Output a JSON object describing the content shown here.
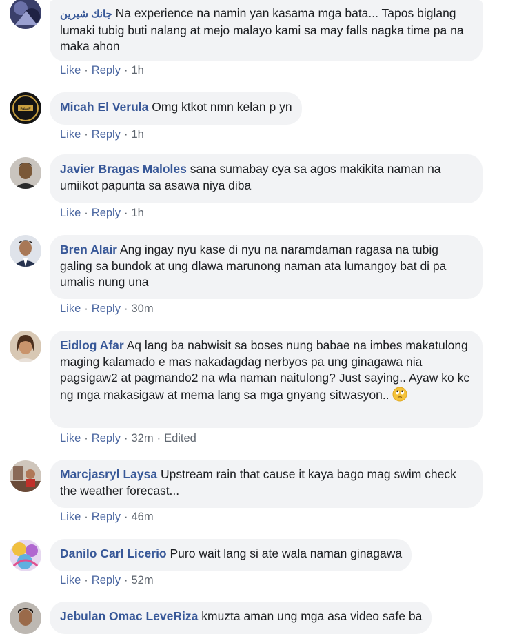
{
  "comments": [
    {
      "author": "جانك شيرين",
      "text": "Na experience na namin yan kasama mga bata... Tapos biglang lumaki tubig buti nalang at mejo malayo kami sa may falls nagka time pa na maka ahon",
      "like": "Like",
      "reply": "Reply",
      "time": "1h",
      "edited": ""
    },
    {
      "author": "Micah El Verula",
      "text": "Omg ktkot nmn kelan p yn",
      "like": "Like",
      "reply": "Reply",
      "time": "1h",
      "edited": ""
    },
    {
      "author": "Javier Bragas Maloles",
      "text": "sana sumabay cya sa agos makikita naman na umiikot papunta sa asawa niya diba",
      "like": "Like",
      "reply": "Reply",
      "time": "1h",
      "edited": ""
    },
    {
      "author": "Bren Alair",
      "text": "Ang ingay nyu kase di nyu na naramdaman ragasa na tubig galing sa bundok at ung dlawa marunong naman ata lumangoy bat di pa umalis nung una",
      "like": "Like",
      "reply": "Reply",
      "time": "30m",
      "edited": ""
    },
    {
      "author": "Eidlog Afar",
      "text": "Aq lang ba nabwisit sa boses nung babae na imbes makatulong maging kalamado e mas nakadagdag nerbyos pa ung ginagawa nia pagsigaw2 at pagmando2 na wla naman naitulong? Just saying.. Ayaw ko kc ng mga makasigaw at mema lang sa mga gnyang sitwasyon..",
      "like": "Like",
      "reply": "Reply",
      "time": "32m",
      "edited": "Edited"
    },
    {
      "author": "Marcjasryl Laysa",
      "text": "Upstream rain that cause it kaya bago mag swim check the weather forecast...",
      "like": "Like",
      "reply": "Reply",
      "time": "46m",
      "edited": ""
    },
    {
      "author": "Danilo Carl Licerio",
      "text": "Puro wait lang si ate wala naman ginagawa",
      "like": "Like",
      "reply": "Reply",
      "time": "52m",
      "edited": ""
    },
    {
      "author": "Jebulan Omac LeveRiza",
      "text": "kmuzta aman ung mga asa video safe ba",
      "like": "",
      "reply": "",
      "time": "",
      "edited": ""
    }
  ],
  "colors": {
    "author": "#385898",
    "bubble": "#f2f3f5",
    "action": "#4b67a1",
    "meta": "#606770"
  },
  "icons": [
    "rolling-eyes-emoji-icon"
  ]
}
